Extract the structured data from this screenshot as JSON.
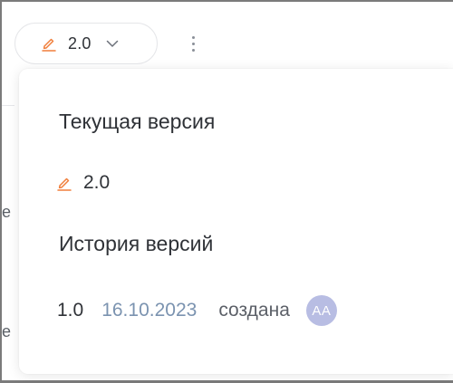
{
  "toolbar": {
    "version_label": "2.0",
    "edit_icon": "pencil-underline-icon",
    "chevron_icon": "chevron-down-icon",
    "more_icon": "kebab-menu-icon"
  },
  "dropdown": {
    "current_title": "Текущая версия",
    "current_version": "2.0",
    "history_title": "История версий",
    "history": [
      {
        "version": "1.0",
        "date": "16.10.2023",
        "action": "создана",
        "author_initials": "АА"
      }
    ]
  },
  "background_page": {
    "glyph_1": "e",
    "glyph_2": "e"
  },
  "colors": {
    "accent_orange": "#f07f3c",
    "date_blue": "#7b93b0",
    "avatar_bg": "#b8bde3"
  }
}
